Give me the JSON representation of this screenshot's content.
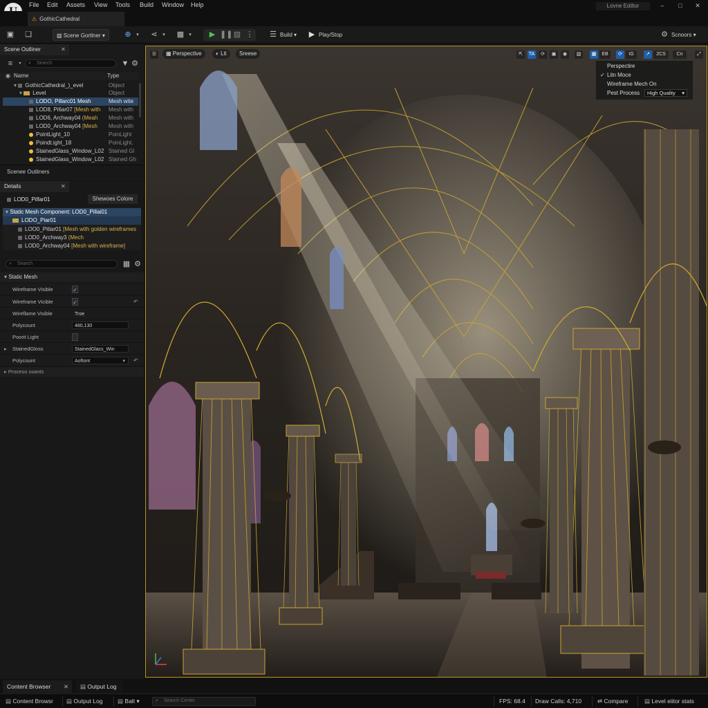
{
  "app": {
    "logo_letter": "U",
    "title": "Lovne Ediltor",
    "level_tab": "GothicCathedral",
    "menu": [
      "File",
      "Edit",
      "Assets",
      "View",
      "Tools",
      "Build",
      "Window",
      "Help"
    ]
  },
  "toolbar": {
    "mode_label": "Scene Gortlner",
    "build_label": "Build",
    "play_label": "Play/Stop",
    "right_label": "Scnoors"
  },
  "outliner": {
    "tab_label": "Scene Outliner",
    "search_placeholder": "Search",
    "col_name": "Name",
    "col_type": "Type",
    "rows": [
      {
        "name": "GothicCathedral_)_evel",
        "type": "Object"
      },
      {
        "name": "Level",
        "type": "Object"
      },
      {
        "name": "LODO, Pillarc01 ",
        "name_hl": "Mesh",
        "type": "Mesh wite"
      },
      {
        "name": "LOD8, Pi6ar07 ",
        "name_hl": "[Mesh with",
        "type": "Mesh with"
      },
      {
        "name": "LOD6, Archway04 ",
        "name_hl": "(Meah",
        "type": "Mesh with"
      },
      {
        "name": "LOD0_Archway04 ",
        "name_hl": "[Mesh",
        "type": "Mesh with"
      },
      {
        "name": "PointLight_10",
        "type": "PoinLight"
      },
      {
        "name": "Poindt.ight_18",
        "type": "PoinLight."
      },
      {
        "name": "StainedGlass_Window_L02",
        "type": "Stained Gl"
      },
      {
        "name": "StainedGlass_Window_L02",
        "type": "Stained Gh"
      }
    ],
    "footer": "Scenee Outliners"
  },
  "details": {
    "tab_label": "Details",
    "actor_name": "LOD0_Pilfar01",
    "action_button": "Shewoes Colore",
    "component_rows": [
      {
        "text": "Static Mesh Component: LOD0_Pillai01",
        "hl": ""
      },
      {
        "text": "LODO_Piаr01",
        "hl": ""
      },
      {
        "text": "LOO0_Pitlar01 ",
        "hl": "[Mesh with golden wireframes"
      },
      {
        "text": "LOD0_Archway3 ",
        "hl": "(Mech"
      },
      {
        "text": "LOD0_Archway04 ",
        "hl": "[Mesh with wireframe]"
      }
    ],
    "search_placeholder": "Search",
    "category": "Static Mesh",
    "props": [
      {
        "label": "Wireframe Visible",
        "type": "check",
        "value": "✓"
      },
      {
        "label": "Wireframe Vicible",
        "type": "check",
        "value": "✓"
      },
      {
        "label": "Wireflame Visible",
        "type": "field",
        "value": "Troe"
      },
      {
        "label": "Polycount",
        "type": "field",
        "value": "480,130"
      },
      {
        "label": "Poorit Light",
        "type": "check",
        "value": ""
      },
      {
        "label": "StainedGloss",
        "type": "field",
        "value": "StainedGlacs_Win"
      },
      {
        "label": "Polycount",
        "type": "field",
        "value": "Aoftont"
      }
    ],
    "process_label": "Proceso ssants"
  },
  "viewport": {
    "chip_view": "Perspective",
    "chip_lit": "Lit",
    "chip_third": "Sreese",
    "icons": [
      "TA",
      "EB",
      "IG",
      "2CS",
      "Cn"
    ],
    "menu": {
      "item1": "Perspectire",
      "item2": "Litn Moce",
      "item3": "Wireframe Mech On",
      "pp_label": "Pest Process",
      "pp_value": "High Quality"
    }
  },
  "bottom": {
    "tab1": "Content Browser",
    "tab2": "Output Log"
  },
  "status": {
    "content": "Content Browsr",
    "output": "Output Log",
    "cmd": "Balt",
    "search_placeholder": "Search Center",
    "fps": "FPS: 68.4",
    "draw_calls": "Draw Calls: 4,710",
    "compare": "Compare",
    "level_stats": "Level eiitor stats"
  },
  "colors": {
    "accent_blue": "#1e5fa8",
    "wireframe_gold": "#c9a632",
    "selection": "#2c4560"
  }
}
